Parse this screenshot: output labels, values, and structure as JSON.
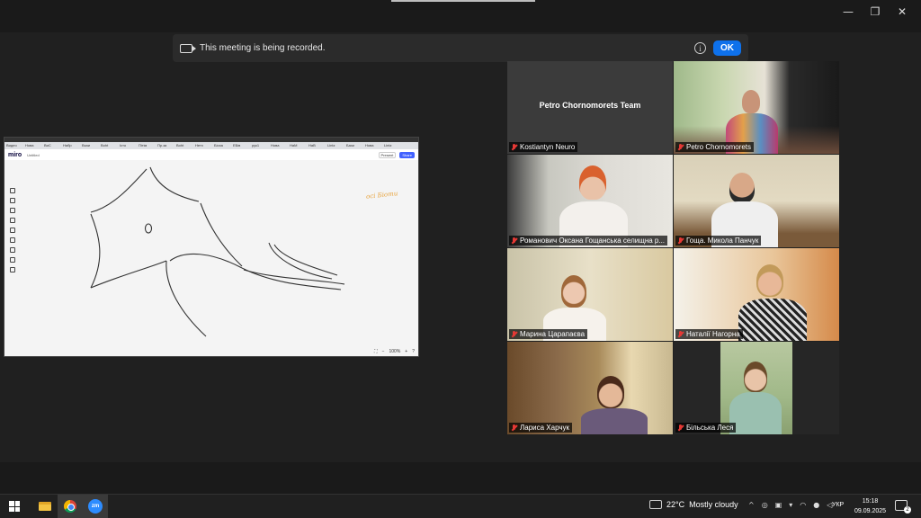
{
  "window": {
    "minimize": "—",
    "restore": "❐",
    "close": "✕"
  },
  "banner": {
    "message": "This meeting is being recorded.",
    "info": "i",
    "ok_label": "OK"
  },
  "share": {
    "tabs": [
      "Видео",
      "Нова",
      "ВиС",
      "Набр",
      "Взаи",
      "Boht",
      "Істо",
      "Пітім",
      "Пр.за",
      "Boht",
      "Нетх",
      "Біоха",
      "ЕБів",
      "рук1",
      "Нова",
      "НаМ",
      "НаВ",
      "Lintz",
      "Бази",
      "Нова",
      "Lintz"
    ],
    "app_name": "miro",
    "board_title": "Untitled",
    "present_label": "Present",
    "share_label": "Share",
    "hand_note": "осі Біоти",
    "zoom_level": "100%",
    "zoom_minus": "−",
    "zoom_plus": "+",
    "help": "?"
  },
  "participants": [
    {
      "name": "Kostiantyn Neuro",
      "label": "Petro Chornomorets Team",
      "active": false
    },
    {
      "name": "Petro Chornomorets",
      "active": true
    },
    {
      "name": "Романович Оксана Гощанська селищна р...",
      "active": false
    },
    {
      "name": "Гоща. Микола Панчук",
      "active": false
    },
    {
      "name": "Марина Царапаєва",
      "active": false
    },
    {
      "name": "Наталії Нагорна",
      "active": false
    },
    {
      "name": "Лариса Харчук",
      "active": false
    },
    {
      "name": "Більська Леся",
      "active": false
    }
  ],
  "taskbar": {
    "zoom_app": "zm",
    "temperature": "22°C",
    "weather": "Mostly cloudy",
    "language": "УКР",
    "time": "15:18",
    "date": "09.09.2025",
    "notifications": "2"
  }
}
